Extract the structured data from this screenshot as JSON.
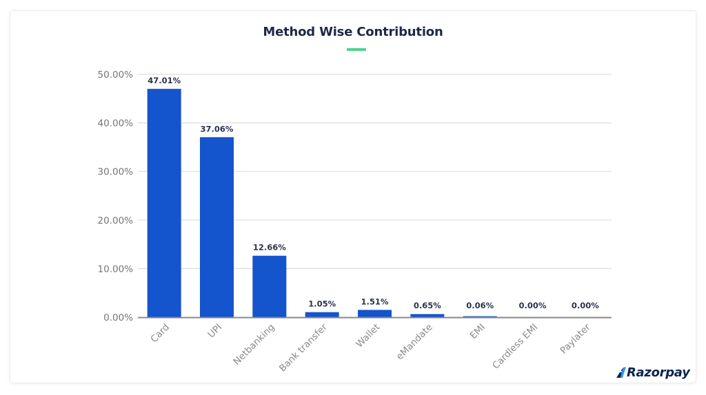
{
  "header": {
    "title": "Method Wise Contribution",
    "accent_color": "#4fd38e"
  },
  "brand": {
    "logo_text": "Razorpay",
    "logo_icon": "razorpay-logo-icon",
    "color": "#0c2451",
    "icon_color": "#3395ff"
  },
  "chart_data": {
    "type": "bar",
    "title": "Method Wise Contribution",
    "xlabel": "",
    "ylabel": "",
    "categories": [
      "Card",
      "UPI",
      "Netbanking",
      "Bank transfer",
      "Wallet",
      "eMandate",
      "EMI",
      "Cardless EMI",
      "Paylater"
    ],
    "values": [
      47.01,
      37.06,
      12.66,
      1.05,
      1.51,
      0.65,
      0.06,
      0.0,
      0.0
    ],
    "data_labels": [
      "47.01%",
      "37.06%",
      "12.66%",
      "1.05%",
      "1.51%",
      "0.65%",
      "0.06%",
      "0.00%",
      "0.00%"
    ],
    "ylim": [
      0,
      50
    ],
    "yticks": [
      0,
      10,
      20,
      30,
      40,
      50
    ],
    "ytick_labels": [
      "0.00%",
      "10.00%",
      "20.00%",
      "30.00%",
      "40.00%",
      "50.00%"
    ],
    "grid": true,
    "legend": "none",
    "bar_color": "#1454cc",
    "x_tick_rotation": "-45deg"
  }
}
